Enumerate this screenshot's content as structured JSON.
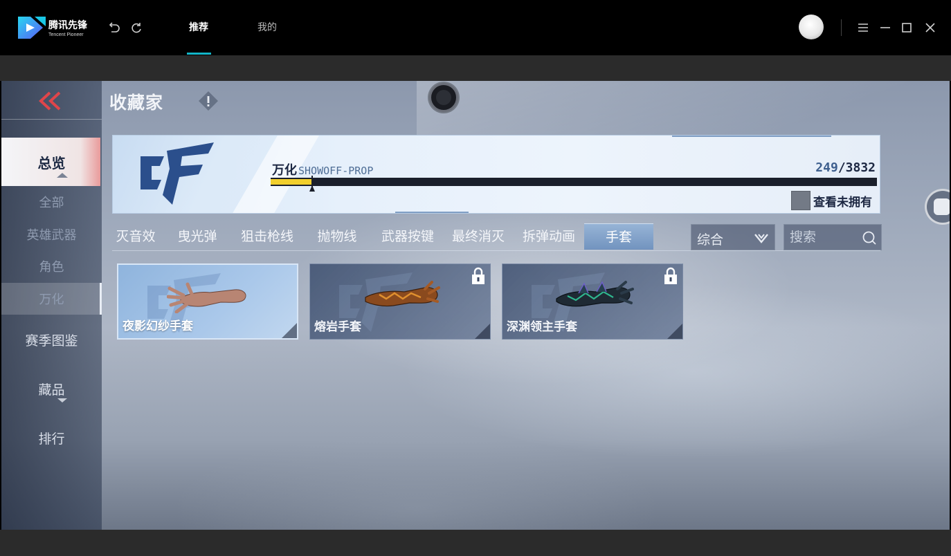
{
  "app": {
    "logo_cn": "腾讯先锋",
    "logo_en": "Tencent Pioneer",
    "nav_tabs": [
      {
        "label": "推荐",
        "active": true
      },
      {
        "label": "我的",
        "active": false
      }
    ],
    "accent_color": "#13b5c8"
  },
  "game": {
    "title": "收藏家",
    "sidebar": {
      "overview": "总览",
      "sub_items": [
        {
          "label": "全部",
          "active": false
        },
        {
          "label": "英雄武器",
          "active": false
        },
        {
          "label": "角色",
          "active": false
        },
        {
          "label": "万化",
          "active": true
        }
      ],
      "season": "赛季图鉴",
      "collection": "藏品",
      "ranking": "排行"
    },
    "banner": {
      "label_cn": "万化",
      "label_en": "SHOWOFF-PROP",
      "owned": "249",
      "total": "/3832",
      "progress": 0.068,
      "progress_color": "#f1cf2d",
      "view_unowned_label": "查看未拥有"
    },
    "tabs": [
      {
        "label": "灭音效",
        "active": false
      },
      {
        "label": "曳光弹",
        "active": false
      },
      {
        "label": "狙击枪线",
        "active": false
      },
      {
        "label": "抛物线",
        "active": false
      },
      {
        "label": "武器按键",
        "active": false
      },
      {
        "label": "最终消灭",
        "active": false
      },
      {
        "label": "拆弹动画",
        "active": false
      },
      {
        "label": "手套",
        "active": true
      }
    ],
    "sort_select": "综合",
    "search_placeholder": "搜索",
    "items": [
      {
        "name": "夜影幻纱手套",
        "locked": false,
        "selected": true
      },
      {
        "name": "熔岩手套",
        "locked": true,
        "selected": false
      },
      {
        "name": "深渊领主手套",
        "locked": true,
        "selected": false
      }
    ]
  }
}
